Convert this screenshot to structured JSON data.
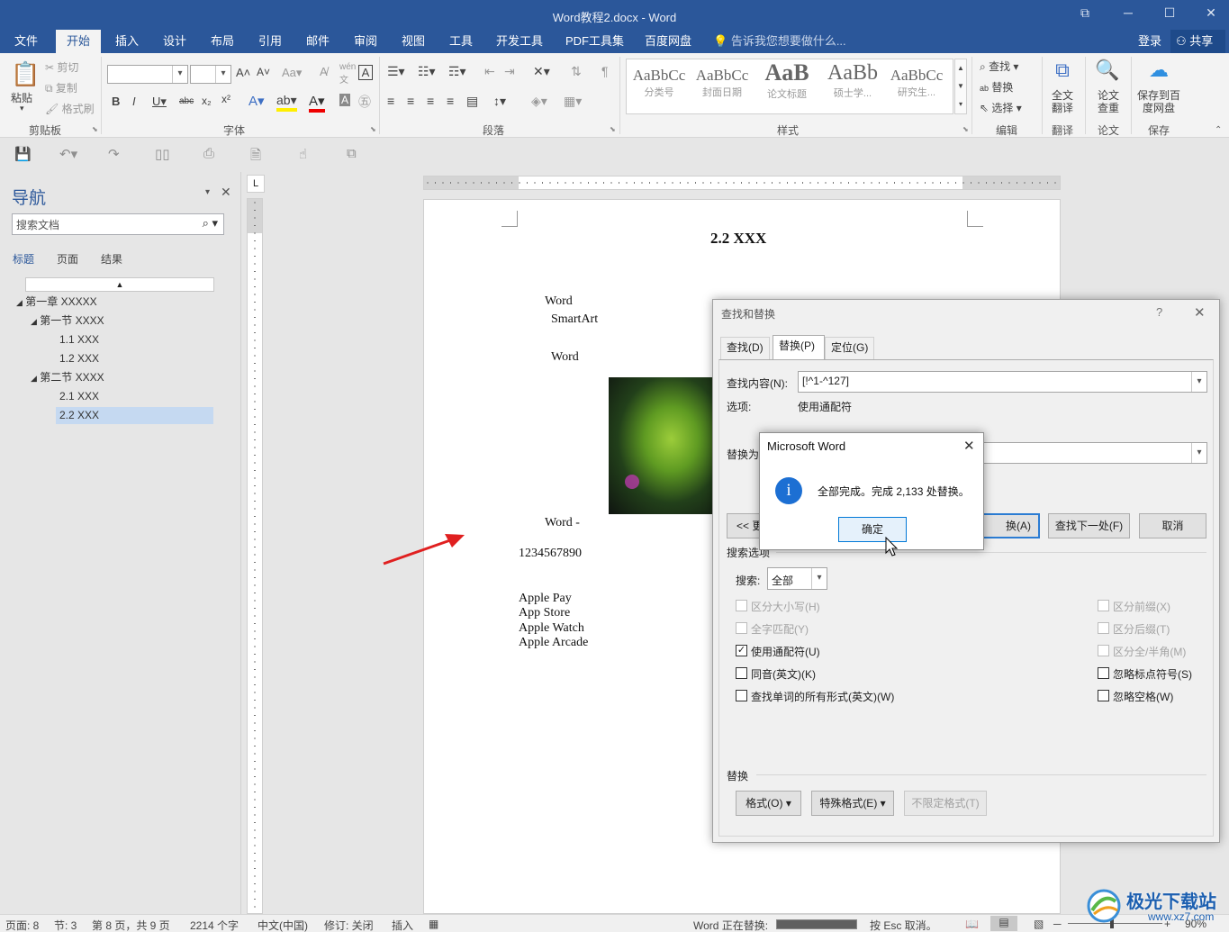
{
  "window": {
    "title": "Word教程2.docx - Word"
  },
  "tabs": [
    "文件",
    "开始",
    "插入",
    "设计",
    "布局",
    "引用",
    "邮件",
    "审阅",
    "视图",
    "工具",
    "开发工具",
    "PDF工具集",
    "百度网盘"
  ],
  "tell_me": "告诉我您想要做什么...",
  "login": "登录",
  "share": "共享",
  "ribbon": {
    "clipboard": {
      "paste": "粘贴",
      "cut": "剪切",
      "copy": "复制",
      "format_painter": "格式刷",
      "label": "剪贴板"
    },
    "font": {
      "label": "字体"
    },
    "paragraph": {
      "label": "段落"
    },
    "styles": {
      "label": "样式",
      "items": [
        {
          "preview": "AaBbCc",
          "name": "分类号"
        },
        {
          "preview": "AaBbCc",
          "name": "封面日期"
        },
        {
          "preview": "AaB",
          "name": "论文标题"
        },
        {
          "preview": "AaBb",
          "name": "硕士学..."
        },
        {
          "preview": "AaBbCc",
          "name": "研究生..."
        }
      ]
    },
    "editing": {
      "find": "查找",
      "replace": "替换",
      "select": "选择",
      "label": "编辑"
    },
    "translate": {
      "btn": "全文翻译",
      "label": "翻译"
    },
    "paper": {
      "btn": "论文查重",
      "label": "论文"
    },
    "save": {
      "btn": "保存到百度网盘",
      "label": "保存"
    }
  },
  "nav": {
    "title": "导航",
    "search_placeholder": "搜索文档",
    "tabs": [
      "标题",
      "页面",
      "结果"
    ],
    "headings": [
      "第一章 XXXXX",
      "第一节 XXXX",
      "1.1 XXX",
      "1.2 XXX",
      "第二节 XXXX",
      "2.1 XXX",
      "2.2 XXX"
    ]
  },
  "doc": {
    "heading": "2.2 XXX",
    "lines": [
      "Word",
      "SmartArt",
      "Word",
      "Word   -",
      "1234567890",
      "Apple Pay",
      "App Store",
      "Apple Watch",
      "Apple Arcade"
    ]
  },
  "find_replace": {
    "title": "查找和替换",
    "help": "?",
    "tabs": [
      "查找(D)",
      "替换(P)",
      "定位(G)"
    ],
    "find_label": "查找内容(N):",
    "find_value": "[!^1-^127]",
    "options_label": "选项:",
    "options_value": "使用通配符",
    "replace_label": "替换为",
    "buttons": {
      "less": "<< 更",
      "replace_all": "换(A)",
      "find_next": "查找下一处(F)",
      "cancel": "取消"
    },
    "search_options_label": "搜索选项",
    "search_label": "搜索:",
    "search_value": "全部",
    "checkboxes_left": [
      {
        "label": "区分大小写(H)",
        "checked": false,
        "enabled": false
      },
      {
        "label": "全字匹配(Y)",
        "checked": false,
        "enabled": false
      },
      {
        "label": "使用通配符(U)",
        "checked": true,
        "enabled": true
      },
      {
        "label": "同音(英文)(K)",
        "checked": false,
        "enabled": true
      },
      {
        "label": "查找单词的所有形式(英文)(W)",
        "checked": false,
        "enabled": true
      }
    ],
    "checkboxes_right": [
      {
        "label": "区分前缀(X)",
        "checked": false,
        "enabled": false
      },
      {
        "label": "区分后缀(T)",
        "checked": false,
        "enabled": false
      },
      {
        "label": "区分全/半角(M)",
        "checked": false,
        "enabled": false
      },
      {
        "label": "忽略标点符号(S)",
        "checked": false,
        "enabled": true
      },
      {
        "label": "忽略空格(W)",
        "checked": false,
        "enabled": true
      }
    ],
    "replace_section_label": "替换",
    "bottom_buttons": {
      "format": "格式(O) ▾",
      "special": "特殊格式(E) ▾",
      "no_format": "不限定格式(T)"
    }
  },
  "msgbox": {
    "title": "Microsoft Word",
    "message": "全部完成。完成 2,133 处替换。",
    "ok": "确定"
  },
  "status": {
    "page": "页面: 8",
    "section": "节: 3",
    "pages": "第 8 页，共 9 页",
    "words": "2214 个字",
    "lang": "中文(中国)",
    "track": "修订: 关闭",
    "insert": "插入",
    "progress_text": "Word 正在替换:",
    "esc": "按 Esc 取消。",
    "zoom": "90%"
  },
  "watermark": {
    "brand": "极光下载站",
    "url": "www.xz7.com"
  }
}
